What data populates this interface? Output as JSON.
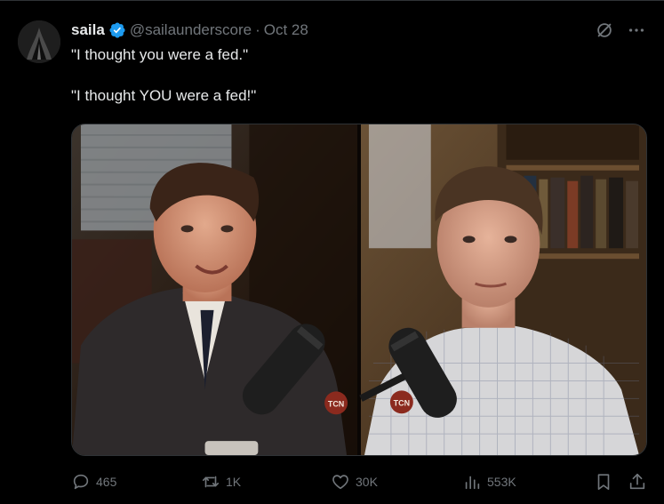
{
  "tweet": {
    "author": {
      "display_name": "saila",
      "handle": "@sailaunderscore",
      "verified": true,
      "avatar_icon": "avatar-image"
    },
    "date": "Oct 28",
    "text_lines": [
      "\"I thought you were a fed.\"",
      "\"I thought YOU were a fed!\""
    ],
    "media": {
      "type": "video-still",
      "logo_text": "TCN"
    },
    "stats": {
      "replies": "465",
      "retweets": "1K",
      "likes": "30K",
      "views": "553K"
    },
    "icons": {
      "grok": "grok-icon",
      "more": "more-icon",
      "reply": "reply-icon",
      "retweet": "retweet-icon",
      "like": "heart-icon",
      "views": "views-icon",
      "bookmark": "bookmark-icon",
      "share": "share-icon"
    },
    "colors": {
      "background": "#000000",
      "text": "#e7e9ea",
      "secondary": "#71767b",
      "verified_blue": "#1d9bf0",
      "border": "#2f3336"
    }
  }
}
